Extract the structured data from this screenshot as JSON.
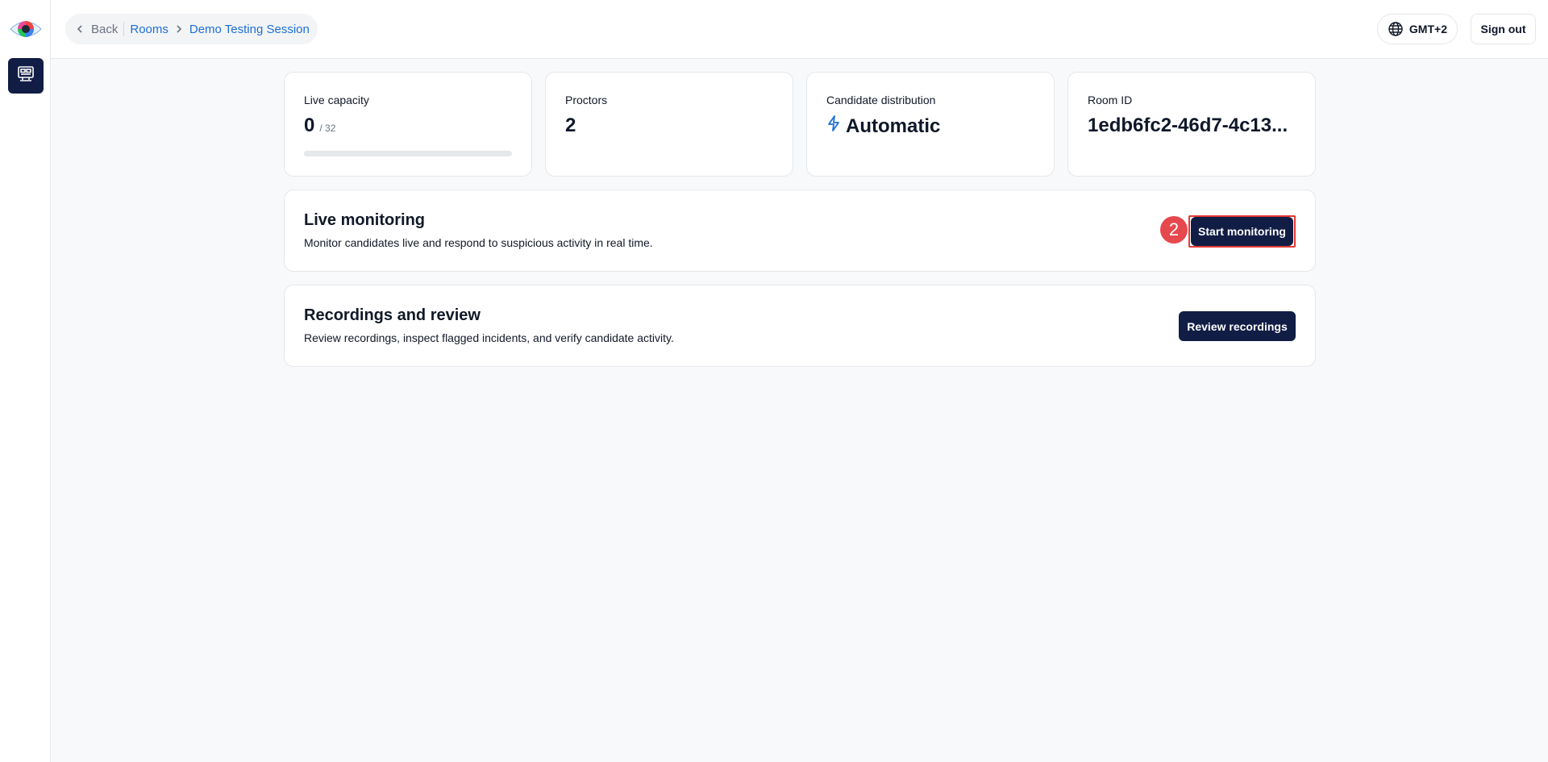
{
  "sidebar": {
    "logo_icon": "eye-logo-icon",
    "nav_icon": "monitor-grid-icon"
  },
  "header": {
    "back_label": "Back",
    "breadcrumb": [
      "Rooms",
      "Demo Testing Session"
    ],
    "timezone": "GMT+2",
    "sign_out": "Sign out"
  },
  "stats": {
    "capacity": {
      "label": "Live capacity",
      "value": "0",
      "max": "/ 32",
      "progress_fraction": 0
    },
    "proctors": {
      "label": "Proctors",
      "value": "2"
    },
    "distribution": {
      "label": "Candidate distribution",
      "value": "Automatic",
      "icon": "lightning-bolt-icon"
    },
    "room": {
      "label": "Room ID",
      "value": "1edb6fc2-46d7-4c13..."
    }
  },
  "live_monitoring": {
    "title": "Live monitoring",
    "description": "Monitor candidates live and respond to suspicious activity in real time.",
    "button": "Start monitoring",
    "step_badge": "2"
  },
  "recordings": {
    "title": "Recordings and review",
    "description": "Review recordings, inspect flagged incidents, and verify candidate activity.",
    "button": "Review recordings"
  },
  "colors": {
    "primary": "#111d45",
    "link": "#1d6fd8",
    "highlight": "#e53935",
    "badge": "#e5484d"
  }
}
